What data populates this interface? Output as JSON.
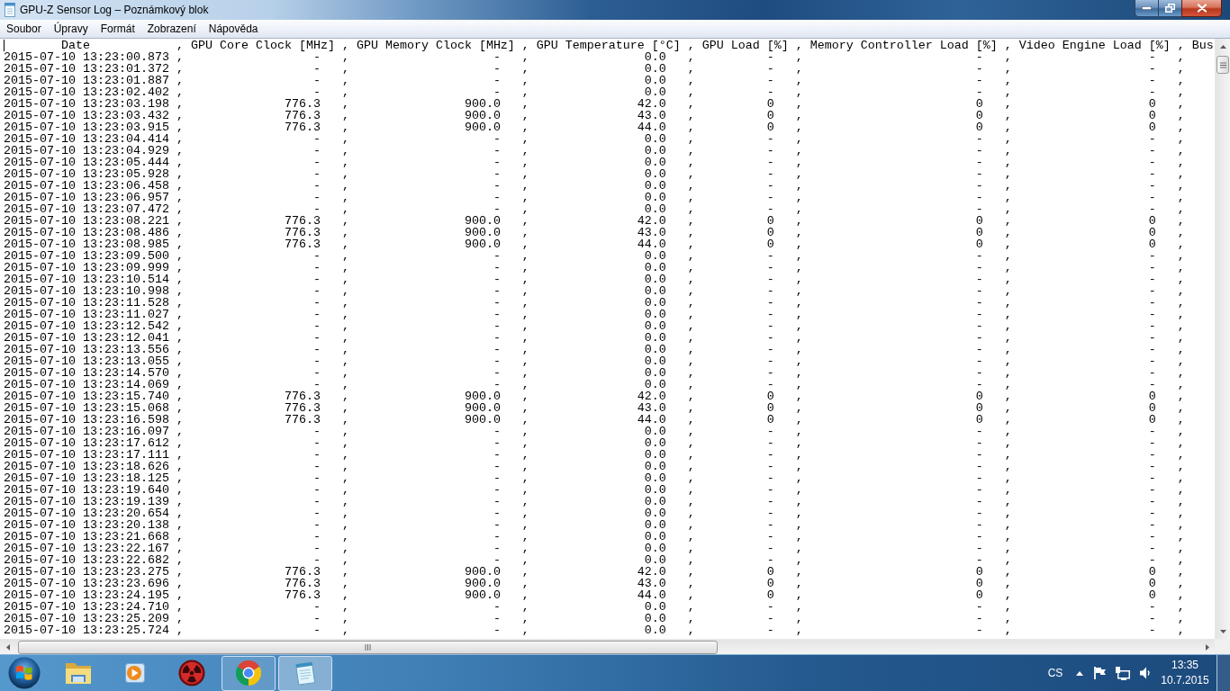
{
  "window": {
    "title": "GPU-Z Sensor Log – Poznámkový blok"
  },
  "menu": [
    "Soubor",
    "Úpravy",
    "Formát",
    "Zobrazení",
    "Nápověda"
  ],
  "document": {
    "caret": true,
    "lines": [
      "        Date            , GPU Core Clock [MHz] , GPU Memory Clock [MHz] , GPU Temperature [°C] , GPU Load [%] , Memory Controller Load [%] , Video Engine Load [%] , Bus",
      "2015-07-10 13:23:00.873 ,                  -   ,                    -   ,                0.0   ,          -   ,                        -   ,                   -   ,",
      "2015-07-10 13:23:01.372 ,                  -   ,                    -   ,                0.0   ,          -   ,                        -   ,                   -   ,",
      "2015-07-10 13:23:01.887 ,                  -   ,                    -   ,                0.0   ,          -   ,                        -   ,                   -   ,",
      "2015-07-10 13:23:02.402 ,                  -   ,                    -   ,                0.0   ,          -   ,                        -   ,                   -   ,",
      "2015-07-10 13:23:03.198 ,              776.3   ,                900.0   ,               42.0   ,          0   ,                        0   ,                   0   ,",
      "2015-07-10 13:23:03.432 ,              776.3   ,                900.0   ,               43.0   ,          0   ,                        0   ,                   0   ,",
      "2015-07-10 13:23:03.915 ,              776.3   ,                900.0   ,               44.0   ,          0   ,                        0   ,                   0   ,",
      "2015-07-10 13:23:04.414 ,                  -   ,                    -   ,                0.0   ,          -   ,                        -   ,                   -   ,",
      "2015-07-10 13:23:04.929 ,                  -   ,                    -   ,                0.0   ,          -   ,                        -   ,                   -   ,",
      "2015-07-10 13:23:05.444 ,                  -   ,                    -   ,                0.0   ,          -   ,                        -   ,                   -   ,",
      "2015-07-10 13:23:05.928 ,                  -   ,                    -   ,                0.0   ,          -   ,                        -   ,                   -   ,",
      "2015-07-10 13:23:06.458 ,                  -   ,                    -   ,                0.0   ,          -   ,                        -   ,                   -   ,",
      "2015-07-10 13:23:06.957 ,                  -   ,                    -   ,                0.0   ,          -   ,                        -   ,                   -   ,",
      "2015-07-10 13:23:07.472 ,                  -   ,                    -   ,                0.0   ,          -   ,                        -   ,                   -   ,",
      "2015-07-10 13:23:08.221 ,              776.3   ,                900.0   ,               42.0   ,          0   ,                        0   ,                   0   ,",
      "2015-07-10 13:23:08.486 ,              776.3   ,                900.0   ,               43.0   ,          0   ,                        0   ,                   0   ,",
      "2015-07-10 13:23:08.985 ,              776.3   ,                900.0   ,               44.0   ,          0   ,                        0   ,                   0   ,",
      "2015-07-10 13:23:09.500 ,                  -   ,                    -   ,                0.0   ,          -   ,                        -   ,                   -   ,",
      "2015-07-10 13:23:09.999 ,                  -   ,                    -   ,                0.0   ,          -   ,                        -   ,                   -   ,",
      "2015-07-10 13:23:10.514 ,                  -   ,                    -   ,                0.0   ,          -   ,                        -   ,                   -   ,",
      "2015-07-10 13:23:10.998 ,                  -   ,                    -   ,                0.0   ,          -   ,                        -   ,                   -   ,",
      "2015-07-10 13:23:11.528 ,                  -   ,                    -   ,                0.0   ,          -   ,                        -   ,                   -   ,",
      "2015-07-10 13:23:11.027 ,                  -   ,                    -   ,                0.0   ,          -   ,                        -   ,                   -   ,",
      "2015-07-10 13:23:12.542 ,                  -   ,                    -   ,                0.0   ,          -   ,                        -   ,                   -   ,",
      "2015-07-10 13:23:12.041 ,                  -   ,                    -   ,                0.0   ,          -   ,                        -   ,                   -   ,",
      "2015-07-10 13:23:13.556 ,                  -   ,                    -   ,                0.0   ,          -   ,                        -   ,                   -   ,",
      "2015-07-10 13:23:13.055 ,                  -   ,                    -   ,                0.0   ,          -   ,                        -   ,                   -   ,",
      "2015-07-10 13:23:14.570 ,                  -   ,                    -   ,                0.0   ,          -   ,                        -   ,                   -   ,",
      "2015-07-10 13:23:14.069 ,                  -   ,                    -   ,                0.0   ,          -   ,                        -   ,                   -   ,",
      "2015-07-10 13:23:15.740 ,              776.3   ,                900.0   ,               42.0   ,          0   ,                        0   ,                   0   ,",
      "2015-07-10 13:23:15.068 ,              776.3   ,                900.0   ,               43.0   ,          0   ,                        0   ,                   0   ,",
      "2015-07-10 13:23:16.598 ,              776.3   ,                900.0   ,               44.0   ,          0   ,                        0   ,                   0   ,",
      "2015-07-10 13:23:16.097 ,                  -   ,                    -   ,                0.0   ,          -   ,                        -   ,                   -   ,",
      "2015-07-10 13:23:17.612 ,                  -   ,                    -   ,                0.0   ,          -   ,                        -   ,                   -   ,",
      "2015-07-10 13:23:17.111 ,                  -   ,                    -   ,                0.0   ,          -   ,                        -   ,                   -   ,",
      "2015-07-10 13:23:18.626 ,                  -   ,                    -   ,                0.0   ,          -   ,                        -   ,                   -   ,",
      "2015-07-10 13:23:18.125 ,                  -   ,                    -   ,                0.0   ,          -   ,                        -   ,                   -   ,",
      "2015-07-10 13:23:19.640 ,                  -   ,                    -   ,                0.0   ,          -   ,                        -   ,                   -   ,",
      "2015-07-10 13:23:19.139 ,                  -   ,                    -   ,                0.0   ,          -   ,                        -   ,                   -   ,",
      "2015-07-10 13:23:20.654 ,                  -   ,                    -   ,                0.0   ,          -   ,                        -   ,                   -   ,",
      "2015-07-10 13:23:20.138 ,                  -   ,                    -   ,                0.0   ,          -   ,                        -   ,                   -   ,",
      "2015-07-10 13:23:21.668 ,                  -   ,                    -   ,                0.0   ,          -   ,                        -   ,                   -   ,",
      "2015-07-10 13:23:22.167 ,                  -   ,                    -   ,                0.0   ,          -   ,                        -   ,                   -   ,",
      "2015-07-10 13:23:22.682 ,                  -   ,                    -   ,                0.0   ,          -   ,                        -   ,                   -   ,",
      "2015-07-10 13:23:23.275 ,              776.3   ,                900.0   ,               42.0   ,          0   ,                        0   ,                   0   ,",
      "2015-07-10 13:23:23.696 ,              776.3   ,                900.0   ,               43.0   ,          0   ,                        0   ,                   0   ,",
      "2015-07-10 13:23:24.195 ,              776.3   ,                900.0   ,               44.0   ,          0   ,                        0   ,                   0   ,",
      "2015-07-10 13:23:24.710 ,                  -   ,                    -   ,                0.0   ,          -   ,                        -   ,                   -   ,",
      "2015-07-10 13:23:25.209 ,                  -   ,                    -   ,                0.0   ,          -   ,                        -   ,                   -   ,",
      "2015-07-10 13:23:25.724 ,                  -   ,                    -   ,                0.0   ,          -   ,                        -   ,                   -   ,"
    ]
  },
  "taskbar": {
    "items": [
      {
        "running": false,
        "selected": false
      },
      {
        "running": false,
        "selected": false
      },
      {
        "running": false,
        "selected": false
      },
      {
        "running": true,
        "selected": false
      },
      {
        "running": true,
        "selected": true
      }
    ],
    "tray": {
      "language": "CS",
      "time": "13:35",
      "date": "10.7.2015"
    }
  }
}
